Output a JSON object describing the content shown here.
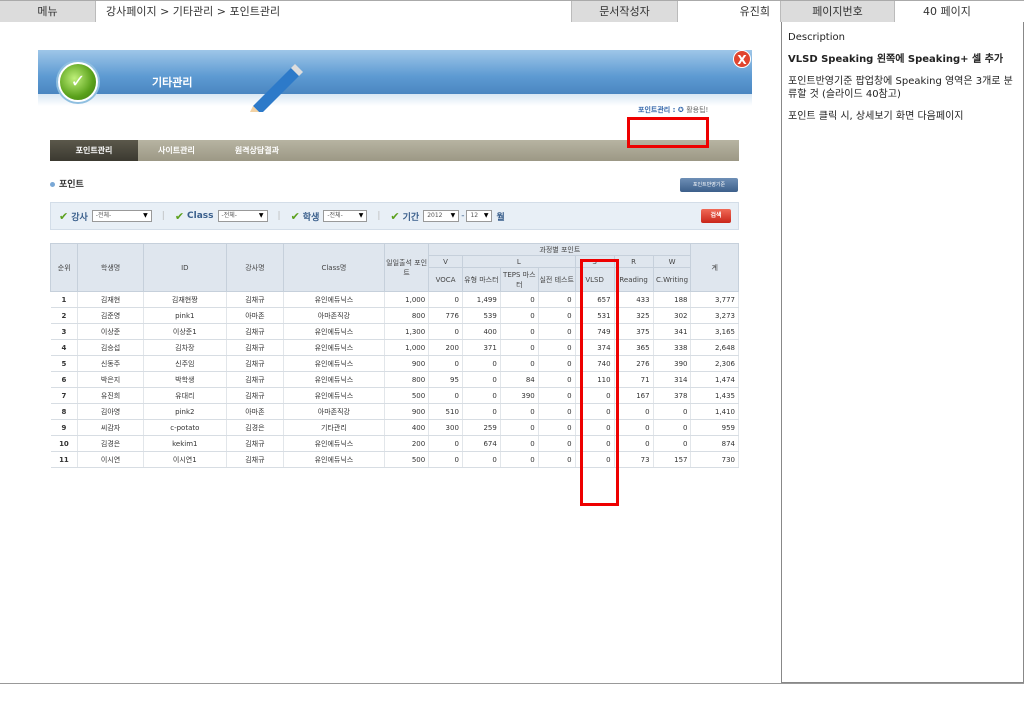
{
  "header": {
    "menu_label": "메뉴",
    "menu_value": "강사페이지 > 기타관리 > 포인트관리",
    "author_label": "문서작성자",
    "author_value": "유진희",
    "page_label": "페이지번호",
    "page_value": "40 페이지"
  },
  "description": {
    "title": "Description",
    "lines": [
      "VLSD Speaking 왼쪽에 Speaking+  셀 추가",
      "포인트반영기준 팝업창에 Speaking 영역은 3개로 분류할 것 (슬라이드 40참고)",
      "포인트 클릭 시, 상세보기 화면 다음페이지"
    ]
  },
  "popup": {
    "title": "기타관리",
    "close_label": "X",
    "breadcrumb_link": "포인트관리 :",
    "breadcrumb_text": "활용팁!",
    "tabs": [
      "포인트관리",
      "사이트관리",
      "원격상담결과"
    ],
    "section_title": "포인트",
    "criteria_button": "포인트반영기준",
    "filters": {
      "teacher_label": "강사",
      "teacher_value": "-전체-",
      "class_label": "Class",
      "class_value": "-전체-",
      "student_label": "학생",
      "student_value": "-전체-",
      "period_label": "기간",
      "year_value": "2012",
      "month_value": "12",
      "month_unit": "월",
      "search_button": "검색"
    },
    "table": {
      "group_header": "과정별 포인트",
      "headers": {
        "rank": "순위",
        "student": "학생명",
        "id": "ID",
        "teacher": "강사명",
        "class": "Class명",
        "daily": "일일출석 포인트",
        "v": "V",
        "l": "L",
        "s": "S",
        "r": "R",
        "w": "W",
        "total": "계",
        "voca": "VOCA",
        "type_master": "유형 마스터",
        "teps_master": "TEPS 마스터",
        "real_test": "실전 테스트",
        "vlsd": "VLSD",
        "reading": "Reading",
        "cwriting": "C.Writing"
      },
      "rows": [
        [
          "1",
          "김재현",
          "김재현짱",
          "김채규",
          "유인에듀닉스",
          "1,000",
          "0",
          "1,499",
          "0",
          "0",
          "657",
          "433",
          "188",
          "3,777"
        ],
        [
          "2",
          "김준영",
          "pink1",
          "아마존",
          "아마존직강",
          "800",
          "776",
          "539",
          "0",
          "0",
          "531",
          "325",
          "302",
          "3,273"
        ],
        [
          "3",
          "이상준",
          "이상준1",
          "김채규",
          "유인에듀닉스",
          "1,300",
          "0",
          "400",
          "0",
          "0",
          "749",
          "375",
          "341",
          "3,165"
        ],
        [
          "4",
          "김승섭",
          "김차장",
          "김채규",
          "유인에듀닉스",
          "1,000",
          "200",
          "371",
          "0",
          "0",
          "374",
          "365",
          "338",
          "2,648"
        ],
        [
          "5",
          "신동주",
          "신주임",
          "김채규",
          "유인에듀닉스",
          "900",
          "0",
          "0",
          "0",
          "0",
          "740",
          "276",
          "390",
          "2,306"
        ],
        [
          "6",
          "박은지",
          "박학생",
          "김채규",
          "유인에듀닉스",
          "800",
          "95",
          "0",
          "84",
          "0",
          "110",
          "71",
          "314",
          "1,474"
        ],
        [
          "7",
          "유진희",
          "유대리",
          "김채규",
          "유인에듀닉스",
          "500",
          "0",
          "0",
          "390",
          "0",
          "0",
          "167",
          "378",
          "1,435"
        ],
        [
          "8",
          "김아영",
          "pink2",
          "아마존",
          "아마존직강",
          "900",
          "510",
          "0",
          "0",
          "0",
          "0",
          "0",
          "0",
          "1,410"
        ],
        [
          "9",
          "씨감자",
          "c-potato",
          "김경은",
          "기타관리",
          "400",
          "300",
          "259",
          "0",
          "0",
          "0",
          "0",
          "0",
          "959"
        ],
        [
          "10",
          "김경은",
          "kekim1",
          "김채규",
          "유인에듀닉스",
          "200",
          "0",
          "674",
          "0",
          "0",
          "0",
          "0",
          "0",
          "874"
        ],
        [
          "11",
          "이시연",
          "이시연1",
          "김채규",
          "유인에듀닉스",
          "500",
          "0",
          "0",
          "0",
          "0",
          "0",
          "73",
          "157",
          "730"
        ]
      ]
    }
  },
  "colors": {
    "highlight": "#ee0000",
    "header_blue": "#5d9ad2",
    "tab_bar": "#9c9885",
    "table_header": "#dfe6ee"
  }
}
